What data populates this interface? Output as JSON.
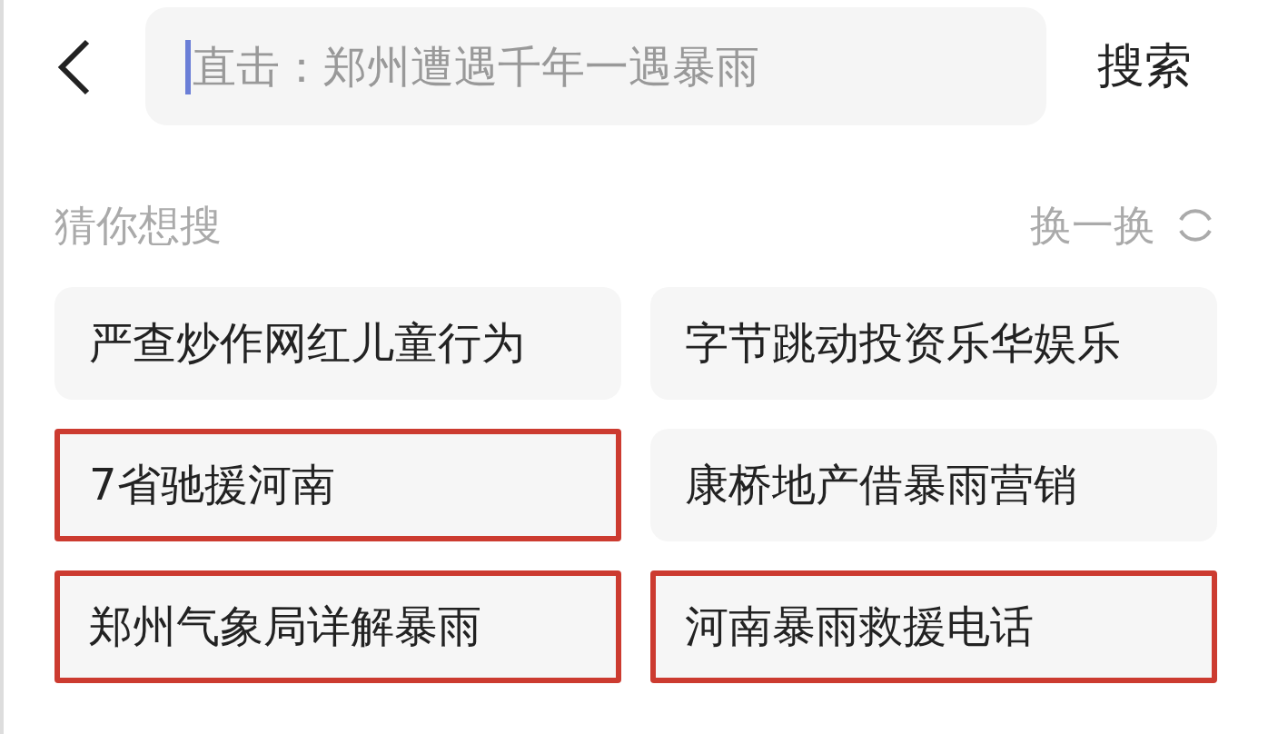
{
  "search": {
    "placeholder": "直击：郑州遭遇千年一遇暴雨",
    "button": "搜索"
  },
  "suggestions": {
    "title": "猜你想搜",
    "refresh": "换一换",
    "items": [
      {
        "label": "严查炒作网红儿童行为",
        "highlighted": false
      },
      {
        "label": "字节跳动投资乐华娱乐",
        "highlighted": false
      },
      {
        "label": "7省驰援河南",
        "highlighted": true
      },
      {
        "label": "康桥地产借暴雨营销",
        "highlighted": false
      },
      {
        "label": "郑州气象局详解暴雨",
        "highlighted": true
      },
      {
        "label": "河南暴雨救援电话",
        "highlighted": true
      }
    ]
  }
}
